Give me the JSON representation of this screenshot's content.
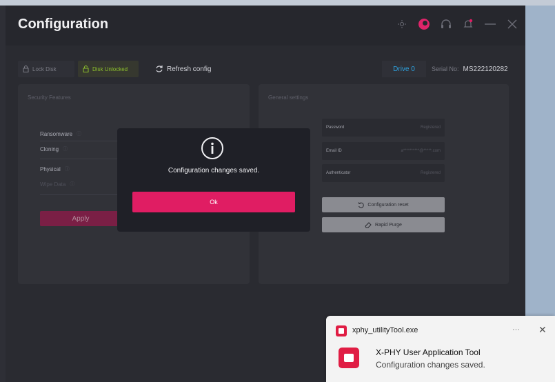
{
  "app": {
    "title": "Configuration"
  },
  "toolbar": {
    "lock_label": "Lock Disk",
    "unlocked_label": "Disk Unlocked",
    "refresh_label": "Refresh config",
    "drive_label": "Drive 0",
    "serial_label": "Serial No:",
    "serial_value": "MS222120282"
  },
  "security": {
    "title": "Security Features",
    "features": [
      "Ransomware",
      "Cloning",
      "Physical",
      "Wipe Data"
    ],
    "apply_label": "Apply"
  },
  "general": {
    "title": "General settings",
    "password_label": "Password",
    "password_value": "Registered",
    "email_label": "Email ID",
    "email_value": "a**********@*****.com",
    "auth_label": "Authenticator",
    "auth_value": "Registered",
    "reset_label": "Configuration reset",
    "purge_label": "Rapid Purge"
  },
  "dialog": {
    "message": "Configuration changes saved.",
    "ok_label": "Ok"
  },
  "toast": {
    "app_name": "xphy_utilityTool.exe",
    "more": "···",
    "close": "✕",
    "title": "X-PHY User Application Tool",
    "body": "Configuration changes saved."
  },
  "colors": {
    "accent": "#e01d63",
    "unlocked": "#8cbf2d",
    "drive": "#2ea2df"
  }
}
